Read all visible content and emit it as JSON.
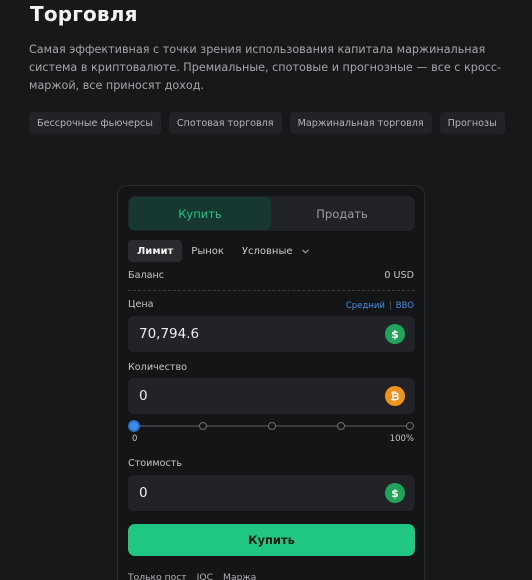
{
  "section": {
    "title": "Торговля",
    "description": "Самая эффективная с точки зрения использования капитала маржинальная система в криптовалюте. Премиальные, спотовые и прогнозные — все с кросс-маржой, все приносят доход."
  },
  "tags": [
    "Бессрочные фьючерсы",
    "Спотовая торговля",
    "Маржинальная торговля",
    "Прогнозы"
  ],
  "order_panel": {
    "side_tabs": {
      "buy": "Купить",
      "sell": "Продать",
      "selected": "buy"
    },
    "order_types": {
      "limit": "Лимит",
      "market": "Рынок",
      "conditional": "Условные",
      "selected": "limit"
    },
    "balance": {
      "label": "Баланс",
      "value": "0 USD"
    },
    "price": {
      "label": "Цена",
      "mid_link": "Средний",
      "separator": "|",
      "bbo_link": "BBO",
      "value": "70,794.6",
      "currency_icon": "usd-coin-icon"
    },
    "quantity": {
      "label": "Количество",
      "value": "0",
      "currency_icon": "btc-coin-icon"
    },
    "slider": {
      "min_label": "0",
      "max_label": "100%",
      "value_percent": 0,
      "ticks_percent": [
        0,
        25,
        50,
        75,
        100
      ]
    },
    "cost": {
      "label": "Стоимость",
      "value": "0",
      "currency_icon": "usd-coin-icon"
    },
    "submit_label": "Купить",
    "options": [
      "Только пост",
      "IOC",
      "Маржа"
    ]
  },
  "colors": {
    "accent_green": "#20c783",
    "link_blue": "#3d8ff0",
    "usd_green": "#21a35b",
    "btc_orange": "#f29218"
  }
}
